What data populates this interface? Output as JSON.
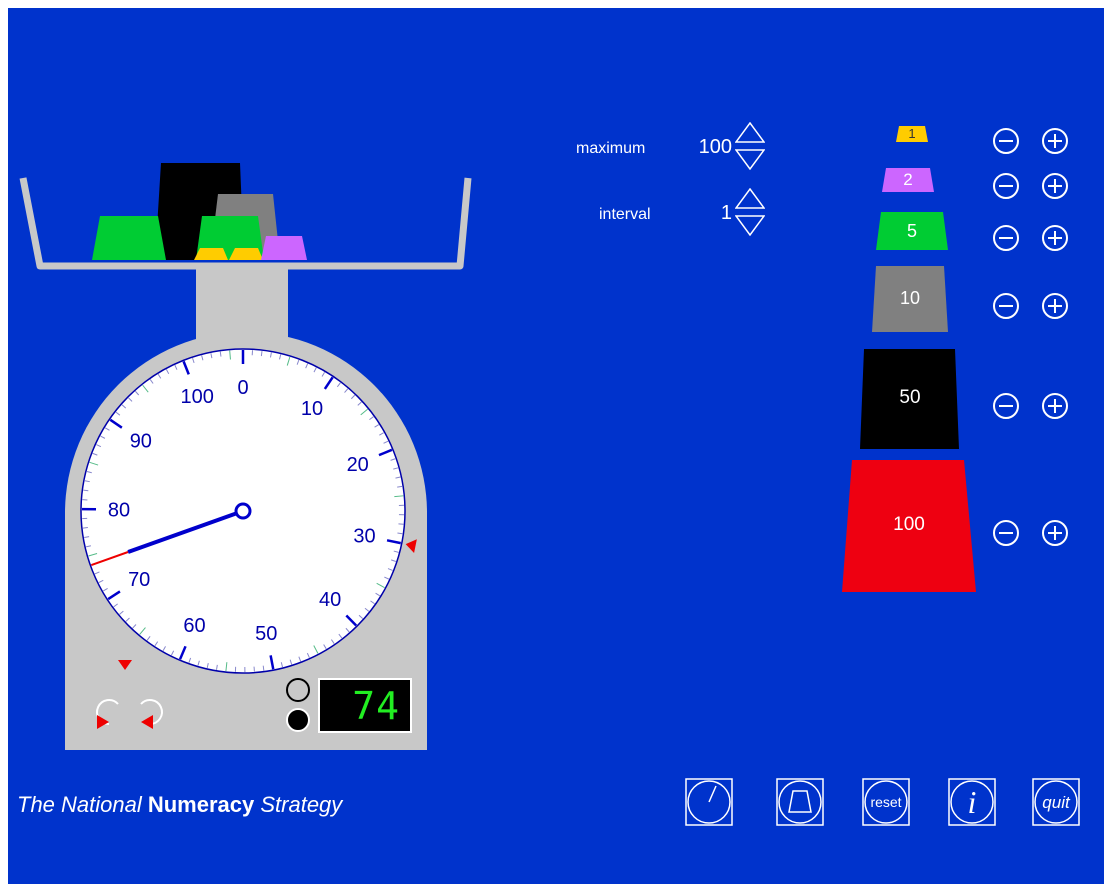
{
  "controls": {
    "maximum_label": "maximum",
    "maximum_value": "100",
    "interval_label": "interval",
    "interval_value": "1"
  },
  "dial": {
    "numbers": [
      "0",
      "10",
      "20",
      "30",
      "40",
      "50",
      "60",
      "70",
      "80",
      "90",
      "100"
    ],
    "maximum": 100,
    "reading": 74,
    "marker_value": 30
  },
  "display": {
    "digital_value": "74"
  },
  "weights": [
    {
      "label": "1",
      "color": "#ffcc00"
    },
    {
      "label": "2",
      "color": "#cc66ff"
    },
    {
      "label": "5",
      "color": "#00cc33"
    },
    {
      "label": "10",
      "color": "#808080"
    },
    {
      "label": "50",
      "color": "#000000"
    },
    {
      "label": "100",
      "color": "#ee0011"
    }
  ],
  "pan_contents": [
    "50",
    "10",
    "5",
    "5",
    "1",
    "1",
    "2"
  ],
  "toolbar": {
    "reset_label": "reset",
    "info_label": "i",
    "quit_label": "quit"
  },
  "footer": {
    "part1": "The National ",
    "part2": "Numeracy",
    "part3": " Strategy"
  },
  "icons": [
    "rotate-anticlockwise-icon",
    "rotate-clockwise-icon",
    "dial-icon",
    "weight-icon",
    "reset-icon",
    "info-icon",
    "quit-icon",
    "minus-icon",
    "plus-icon",
    "up-arrow-icon",
    "down-arrow-icon"
  ]
}
